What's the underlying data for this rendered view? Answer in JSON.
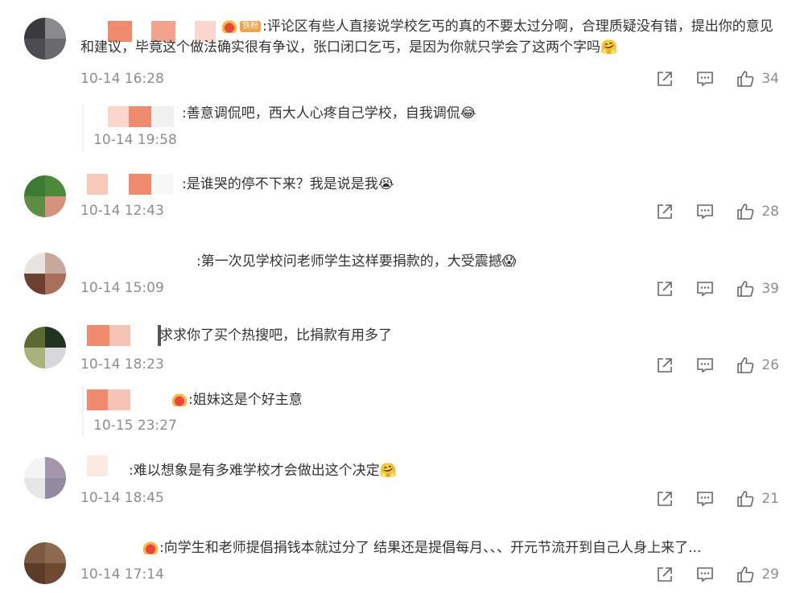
{
  "comments": [
    {
      "text": "评论区有些人直接说学校乞丐的真的不要太过分啊，合理质疑没有错，提出你的意见和建议，毕竟这个做法确实很有争议，张口闭口乞丐，是因为你就只学会了这两个字吗",
      "badge": "铁粉",
      "time": "10-14 16:28",
      "likes": "34",
      "emoji": "🤗"
    },
    {
      "text": "善意调侃吧，西大人心疼自己学校，自我调侃",
      "time": "10-14 19:58",
      "emoji": "😂"
    },
    {
      "text": "是谁哭的停不下来？我是说是我",
      "time": "10-14 12:43",
      "likes": "28",
      "emoji": "😭"
    },
    {
      "text": "第一次见学校问老师学生这样要捐款的，大受震撼",
      "time": "10-14 15:09",
      "likes": "39",
      "emoji": "😱"
    },
    {
      "text": "求求你了买个热搜吧，比捐款有用多了",
      "time": "10-14 18:23",
      "likes": "26"
    },
    {
      "text": "姐妹这是个好主意",
      "time": "10-15 23:27"
    },
    {
      "text": "难以想象是有多难学校才会做出这个决定",
      "time": "10-14 18:45",
      "likes": "21",
      "emoji": "🤗"
    },
    {
      "text": "向学生和老师提倡捐钱本就过分了 结果还是提倡每月、、、开元节流开到自己人身上来了...",
      "time": "10-14 17:14",
      "likes": "29"
    }
  ],
  "icons": {
    "share": "share-icon",
    "comment": "comment-icon",
    "like": "thumbs-up-icon"
  },
  "colors": {
    "time": "#8d8d8d",
    "text": "#333333",
    "badge": "#f4a14a"
  }
}
